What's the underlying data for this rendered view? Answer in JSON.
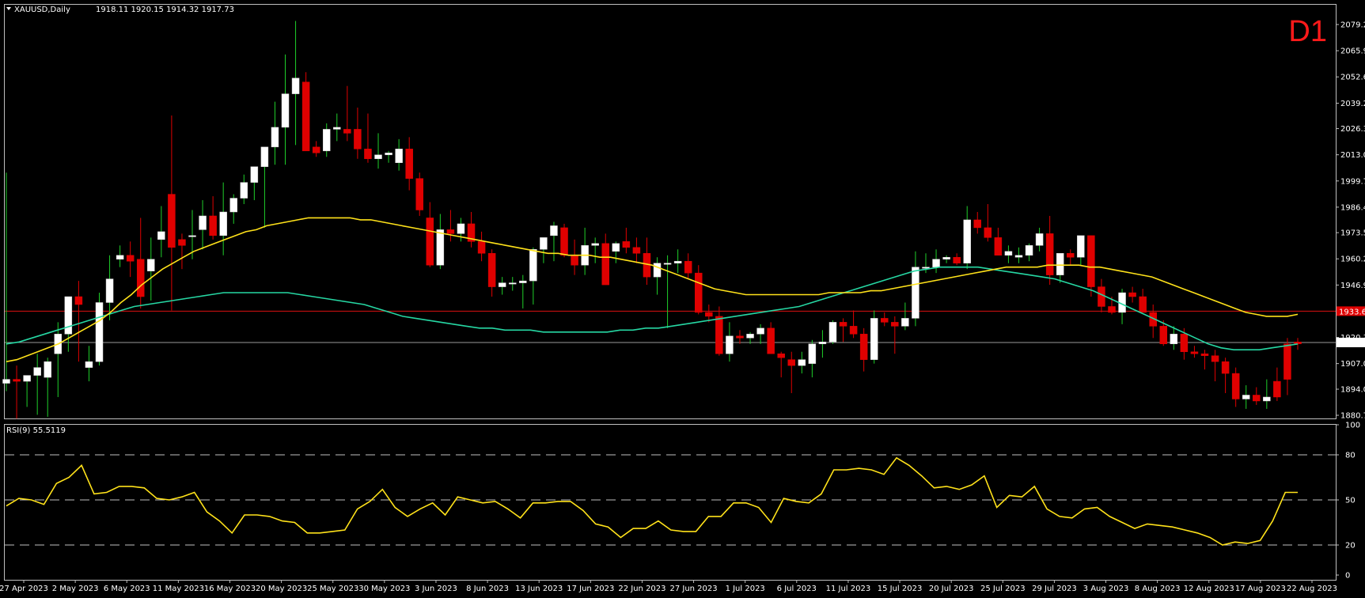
{
  "chart_data": {
    "type": "candlestick",
    "symbol_header": "XAUUSD,Daily",
    "ohlc_header": "1918.11 1920.15 1914.32 1917.73",
    "timeframe_label": "D1",
    "price_axis_ticks": [
      "2079.20",
      "2065.90",
      "2052.60",
      "2039.25",
      "2026.35",
      "2013.05",
      "1999.75",
      "1986.45",
      "1973.50",
      "1960.20",
      "1946.90",
      "1933.60",
      "1920.30",
      "1907.00",
      "1894.00",
      "1880.75"
    ],
    "price_range": [
      1880.75,
      2079.2
    ],
    "horizontal_level": "1933.63",
    "last_price": "1917.73",
    "date_labels": [
      "27 Apr 2023",
      "2 May 2023",
      "6 May 2023",
      "11 May 2023",
      "16 May 2023",
      "20 May 2023",
      "25 May 2023",
      "30 May 2023",
      "3 Jun 2023",
      "8 Jun 2023",
      "13 Jun 2023",
      "17 Jun 2023",
      "22 Jun 2023",
      "27 Jun 2023",
      "1 Jul 2023",
      "6 Jul 2023",
      "11 Jul 2023",
      "15 Jul 2023",
      "20 Jul 2023",
      "25 Jul 2023",
      "29 Jul 2023",
      "3 Aug 2023",
      "8 Aug 2023",
      "12 Aug 2023",
      "17 Aug 2023",
      "22 Aug 2023"
    ],
    "candles": [
      {
        "o": 1897,
        "h": 2004,
        "l": 1893,
        "c": 1899
      },
      {
        "o": 1899,
        "h": 1906,
        "l": 1879,
        "c": 1898
      },
      {
        "o": 1898,
        "h": 1900,
        "l": 1885,
        "c": 1901
      },
      {
        "o": 1901,
        "h": 1912,
        "l": 1881,
        "c": 1905
      },
      {
        "o": 1900,
        "h": 1910,
        "l": 1880,
        "c": 1908
      },
      {
        "o": 1912,
        "h": 1928,
        "l": 1890,
        "c": 1922
      },
      {
        "o": 1922,
        "h": 1938,
        "l": 1913,
        "c": 1941
      },
      {
        "o": 1941,
        "h": 1949,
        "l": 1908,
        "c": 1937
      },
      {
        "o": 1905,
        "h": 1916,
        "l": 1898,
        "c": 1908
      },
      {
        "o": 1908,
        "h": 1943,
        "l": 1906,
        "c": 1938
      },
      {
        "o": 1938,
        "h": 1962,
        "l": 1929,
        "c": 1950
      },
      {
        "o": 1960,
        "h": 1967,
        "l": 1956,
        "c": 1962
      },
      {
        "o": 1962,
        "h": 1969,
        "l": 1951,
        "c": 1959
      },
      {
        "o": 1960,
        "h": 1981,
        "l": 1935,
        "c": 1941
      },
      {
        "o": 1954,
        "h": 1971,
        "l": 1939,
        "c": 1960
      },
      {
        "o": 1970,
        "h": 1987,
        "l": 1961,
        "c": 1974
      },
      {
        "o": 1993,
        "h": 2033,
        "l": 1934,
        "c": 1966
      },
      {
        "o": 1970,
        "h": 1973,
        "l": 1955,
        "c": 1967
      },
      {
        "o": 1972,
        "h": 1985,
        "l": 1960,
        "c": 1972
      },
      {
        "o": 1975,
        "h": 1990,
        "l": 1965,
        "c": 1982
      },
      {
        "o": 1982,
        "h": 1992,
        "l": 1970,
        "c": 1972
      },
      {
        "o": 1972,
        "h": 1999,
        "l": 1962,
        "c": 1984
      },
      {
        "o": 1984,
        "h": 1993,
        "l": 1978,
        "c": 1991
      },
      {
        "o": 1991,
        "h": 2003,
        "l": 1988,
        "c": 1999
      },
      {
        "o": 1999,
        "h": 2007,
        "l": 1990,
        "c": 2007
      },
      {
        "o": 2007,
        "h": 2012,
        "l": 1976,
        "c": 2017
      },
      {
        "o": 2017,
        "h": 2040,
        "l": 2008,
        "c": 2027
      },
      {
        "o": 2027,
        "h": 2064,
        "l": 2008,
        "c": 2044
      },
      {
        "o": 2044,
        "h": 2081,
        "l": 2018,
        "c": 2052
      },
      {
        "o": 2050,
        "h": 2055,
        "l": 2015,
        "c": 2015
      },
      {
        "o": 2017,
        "h": 2020,
        "l": 2012,
        "c": 2014
      },
      {
        "o": 2015,
        "h": 2029,
        "l": 2012,
        "c": 2026
      },
      {
        "o": 2026,
        "h": 2034,
        "l": 2020,
        "c": 2027
      },
      {
        "o": 2026,
        "h": 2048,
        "l": 2020,
        "c": 2024
      },
      {
        "o": 2026,
        "h": 2037,
        "l": 2011,
        "c": 2016
      },
      {
        "o": 2016,
        "h": 2034,
        "l": 2009,
        "c": 2011
      },
      {
        "o": 2011,
        "h": 2024,
        "l": 2006,
        "c": 2013
      },
      {
        "o": 2013,
        "h": 2015,
        "l": 2009,
        "c": 2014
      },
      {
        "o": 2009,
        "h": 2021,
        "l": 2005,
        "c": 2016
      },
      {
        "o": 2016,
        "h": 2022,
        "l": 1995,
        "c": 2001
      },
      {
        "o": 2001,
        "h": 2004,
        "l": 1982,
        "c": 1985
      },
      {
        "o": 1981,
        "h": 1989,
        "l": 1956,
        "c": 1957
      },
      {
        "o": 1957,
        "h": 1983,
        "l": 1955,
        "c": 1975
      },
      {
        "o": 1975,
        "h": 1985,
        "l": 1969,
        "c": 1973
      },
      {
        "o": 1973,
        "h": 1981,
        "l": 1969,
        "c": 1978
      },
      {
        "o": 1978,
        "h": 1984,
        "l": 1966,
        "c": 1969
      },
      {
        "o": 1969,
        "h": 1974,
        "l": 1959,
        "c": 1963
      },
      {
        "o": 1963,
        "h": 1965,
        "l": 1941,
        "c": 1946
      },
      {
        "o": 1946,
        "h": 1951,
        "l": 1942,
        "c": 1948
      },
      {
        "o": 1948,
        "h": 1951,
        "l": 1944,
        "c": 1948
      },
      {
        "o": 1948,
        "h": 1952,
        "l": 1935,
        "c": 1949
      },
      {
        "o": 1949,
        "h": 1966,
        "l": 1937,
        "c": 1965
      },
      {
        "o": 1965,
        "h": 1969,
        "l": 1958,
        "c": 1971
      },
      {
        "o": 1972,
        "h": 1979,
        "l": 1959,
        "c": 1977
      },
      {
        "o": 1976,
        "h": 1978,
        "l": 1961,
        "c": 1962
      },
      {
        "o": 1962,
        "h": 1970,
        "l": 1952,
        "c": 1957
      },
      {
        "o": 1957,
        "h": 1976,
        "l": 1952,
        "c": 1967
      },
      {
        "o": 1967,
        "h": 1971,
        "l": 1958,
        "c": 1968
      },
      {
        "o": 1968,
        "h": 1973,
        "l": 1947,
        "c": 1947
      },
      {
        "o": 1964,
        "h": 1969,
        "l": 1958,
        "c": 1968
      },
      {
        "o": 1969,
        "h": 1976,
        "l": 1963,
        "c": 1966
      },
      {
        "o": 1966,
        "h": 1971,
        "l": 1958,
        "c": 1963
      },
      {
        "o": 1963,
        "h": 1971,
        "l": 1947,
        "c": 1951
      },
      {
        "o": 1951,
        "h": 1961,
        "l": 1942,
        "c": 1958
      },
      {
        "o": 1958,
        "h": 1962,
        "l": 1925,
        "c": 1958
      },
      {
        "o": 1958,
        "h": 1965,
        "l": 1953,
        "c": 1959
      },
      {
        "o": 1959,
        "h": 1963,
        "l": 1950,
        "c": 1953
      },
      {
        "o": 1953,
        "h": 1957,
        "l": 1932,
        "c": 1933
      },
      {
        "o": 1933,
        "h": 1937,
        "l": 1928,
        "c": 1931
      },
      {
        "o": 1931,
        "h": 1936,
        "l": 1911,
        "c": 1912
      },
      {
        "o": 1912,
        "h": 1928,
        "l": 1908,
        "c": 1921
      },
      {
        "o": 1921,
        "h": 1924,
        "l": 1917,
        "c": 1920
      },
      {
        "o": 1920,
        "h": 1923,
        "l": 1917,
        "c": 1922
      },
      {
        "o": 1922,
        "h": 1927,
        "l": 1917,
        "c": 1925
      },
      {
        "o": 1925,
        "h": 1928,
        "l": 1914,
        "c": 1912
      },
      {
        "o": 1912,
        "h": 1913,
        "l": 1900,
        "c": 1910
      },
      {
        "o": 1909,
        "h": 1913,
        "l": 1892,
        "c": 1906
      },
      {
        "o": 1906,
        "h": 1913,
        "l": 1902,
        "c": 1909
      },
      {
        "o": 1907,
        "h": 1919,
        "l": 1900,
        "c": 1917
      },
      {
        "o": 1917,
        "h": 1924,
        "l": 1910,
        "c": 1918
      },
      {
        "o": 1918,
        "h": 1929,
        "l": 1917,
        "c": 1928
      },
      {
        "o": 1928,
        "h": 1930,
        "l": 1918,
        "c": 1926
      },
      {
        "o": 1926,
        "h": 1934,
        "l": 1920,
        "c": 1922
      },
      {
        "o": 1922,
        "h": 1925,
        "l": 1903,
        "c": 1909
      },
      {
        "o": 1909,
        "h": 1934,
        "l": 1907,
        "c": 1930
      },
      {
        "o": 1930,
        "h": 1933,
        "l": 1926,
        "c": 1928
      },
      {
        "o": 1928,
        "h": 1931,
        "l": 1912,
        "c": 1926
      },
      {
        "o": 1926,
        "h": 1938,
        "l": 1924,
        "c": 1930
      },
      {
        "o": 1930,
        "h": 1964,
        "l": 1926,
        "c": 1956
      },
      {
        "o": 1956,
        "h": 1963,
        "l": 1953,
        "c": 1956
      },
      {
        "o": 1956,
        "h": 1965,
        "l": 1953,
        "c": 1960
      },
      {
        "o": 1960,
        "h": 1962,
        "l": 1958,
        "c": 1961
      },
      {
        "o": 1961,
        "h": 1963,
        "l": 1957,
        "c": 1958
      },
      {
        "o": 1958,
        "h": 1987,
        "l": 1955,
        "c": 1980
      },
      {
        "o": 1980,
        "h": 1984,
        "l": 1973,
        "c": 1976
      },
      {
        "o": 1976,
        "h": 1988,
        "l": 1969,
        "c": 1971
      },
      {
        "o": 1971,
        "h": 1976,
        "l": 1962,
        "c": 1962
      },
      {
        "o": 1962,
        "h": 1967,
        "l": 1958,
        "c": 1964
      },
      {
        "o": 1961,
        "h": 1966,
        "l": 1958,
        "c": 1962
      },
      {
        "o": 1962,
        "h": 1968,
        "l": 1959,
        "c": 1967
      },
      {
        "o": 1967,
        "h": 1976,
        "l": 1964,
        "c": 1973
      },
      {
        "o": 1973,
        "h": 1982,
        "l": 1947,
        "c": 1952
      },
      {
        "o": 1952,
        "h": 1963,
        "l": 1948,
        "c": 1963
      },
      {
        "o": 1963,
        "h": 1965,
        "l": 1957,
        "c": 1961
      },
      {
        "o": 1961,
        "h": 1972,
        "l": 1957,
        "c": 1972
      },
      {
        "o": 1972,
        "h": 1972,
        "l": 1941,
        "c": 1946
      },
      {
        "o": 1946,
        "h": 1950,
        "l": 1933,
        "c": 1936
      },
      {
        "o": 1936,
        "h": 1941,
        "l": 1932,
        "c": 1933
      },
      {
        "o": 1933,
        "h": 1945,
        "l": 1927,
        "c": 1943
      },
      {
        "o": 1943,
        "h": 1946,
        "l": 1938,
        "c": 1941
      },
      {
        "o": 1941,
        "h": 1945,
        "l": 1934,
        "c": 1933
      },
      {
        "o": 1933,
        "h": 1937,
        "l": 1920,
        "c": 1926
      },
      {
        "o": 1926,
        "h": 1929,
        "l": 1916,
        "c": 1917
      },
      {
        "o": 1917,
        "h": 1926,
        "l": 1914,
        "c": 1922
      },
      {
        "o": 1922,
        "h": 1925,
        "l": 1909,
        "c": 1913
      },
      {
        "o": 1913,
        "h": 1916,
        "l": 1910,
        "c": 1912
      },
      {
        "o": 1912,
        "h": 1914,
        "l": 1904,
        "c": 1911
      },
      {
        "o": 1911,
        "h": 1914,
        "l": 1898,
        "c": 1908
      },
      {
        "o": 1908,
        "h": 1910,
        "l": 1892,
        "c": 1902
      },
      {
        "o": 1902,
        "h": 1905,
        "l": 1885,
        "c": 1889
      },
      {
        "o": 1889,
        "h": 1896,
        "l": 1884,
        "c": 1891
      },
      {
        "o": 1891,
        "h": 1895,
        "l": 1886,
        "c": 1888
      },
      {
        "o": 1888,
        "h": 1899,
        "l": 1884,
        "c": 1890
      },
      {
        "o": 1898,
        "h": 1905,
        "l": 1888,
        "c": 1890
      },
      {
        "o": 1917,
        "h": 1920,
        "l": 1891,
        "c": 1899
      },
      {
        "o": 1918,
        "h": 1920,
        "l": 1914,
        "c": 1917
      }
    ],
    "ma_fast": [
      1908,
      1909,
      1911,
      1913,
      1915,
      1917,
      1920,
      1923,
      1926,
      1929,
      1933,
      1938,
      1942,
      1947,
      1951,
      1955,
      1958,
      1961,
      1964,
      1966,
      1968,
      1970,
      1972,
      1974,
      1975,
      1977,
      1978,
      1979,
      1980,
      1981,
      1981,
      1981,
      1981,
      1981,
      1980,
      1980,
      1979,
      1978,
      1977,
      1976,
      1975,
      1974,
      1973,
      1972,
      1971,
      1970,
      1969,
      1968,
      1967,
      1966,
      1965,
      1964,
      1963,
      1963,
      1962,
      1962,
      1962,
      1961,
      1961,
      1960,
      1959,
      1958,
      1957,
      1955,
      1953,
      1951,
      1949,
      1947,
      1945,
      1944,
      1943,
      1942,
      1942,
      1942,
      1942,
      1942,
      1942,
      1942,
      1942,
      1943,
      1943,
      1943,
      1943,
      1944,
      1944,
      1945,
      1946,
      1947,
      1948,
      1949,
      1950,
      1951,
      1952,
      1953,
      1954,
      1955,
      1956,
      1956,
      1956,
      1956,
      1957,
      1957,
      1957,
      1957,
      1956,
      1956,
      1955,
      1954,
      1953,
      1952,
      1951,
      1949,
      1947,
      1945,
      1943,
      1941,
      1939,
      1937,
      1935,
      1933,
      1932,
      1931,
      1931,
      1931,
      1932
    ],
    "ma_slow": [
      1917,
      1918,
      1920,
      1922,
      1924,
      1926,
      1928,
      1930,
      1932,
      1934,
      1936,
      1937,
      1938,
      1939,
      1940,
      1941,
      1942,
      1943,
      1943,
      1943,
      1943,
      1943,
      1943,
      1942,
      1941,
      1940,
      1939,
      1938,
      1937,
      1935,
      1933,
      1931,
      1930,
      1929,
      1928,
      1927,
      1926,
      1925,
      1925,
      1924,
      1924,
      1924,
      1923,
      1923,
      1923,
      1923,
      1923,
      1923,
      1924,
      1924,
      1925,
      1925,
      1926,
      1927,
      1928,
      1929,
      1930,
      1931,
      1932,
      1933,
      1934,
      1935,
      1936,
      1938,
      1940,
      1942,
      1944,
      1946,
      1948,
      1950,
      1952,
      1954,
      1955,
      1956,
      1956,
      1956,
      1956,
      1955,
      1954,
      1953,
      1952,
      1951,
      1950,
      1948,
      1946,
      1944,
      1941,
      1938,
      1935,
      1932,
      1929,
      1926,
      1923,
      1920,
      1917,
      1915,
      1914,
      1914,
      1914,
      1915,
      1916,
      1917
    ],
    "rsi_label": "RSI(9) 55.5119",
    "rsi_axis_ticks": [
      "100",
      "80",
      "50",
      "20",
      "0"
    ],
    "rsi_levels": [
      80,
      50,
      20
    ],
    "rsi_range": [
      0,
      100
    ],
    "rsi_values": [
      46,
      51,
      50,
      47,
      61,
      65,
      73,
      54,
      55,
      59,
      59,
      58,
      51,
      50,
      52,
      55,
      42,
      36,
      28,
      40,
      40,
      39,
      36,
      35,
      28,
      28,
      29,
      30,
      44,
      49,
      57,
      45,
      39,
      44,
      48,
      40,
      52,
      50,
      48,
      49,
      44,
      38,
      48,
      48,
      49,
      49,
      43,
      34,
      32,
      25,
      31,
      31,
      36,
      30,
      29,
      29,
      39,
      39,
      48,
      48,
      45,
      35,
      51,
      49,
      48,
      54,
      70,
      70,
      71,
      70,
      67,
      78,
      73,
      66,
      58,
      59,
      57,
      60,
      66,
      45,
      53,
      52,
      59,
      44,
      39,
      38,
      44,
      45,
      39,
      35,
      31,
      34,
      33,
      32,
      30,
      28,
      25,
      20,
      22,
      21,
      23,
      36,
      55,
      55
    ]
  }
}
